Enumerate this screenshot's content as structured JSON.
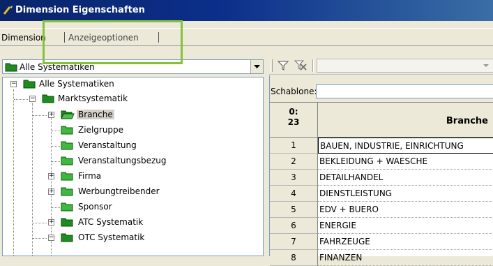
{
  "window": {
    "title": "Dimension Eigenschaften"
  },
  "tabs": [
    {
      "label": "Dimension"
    },
    {
      "label": "Anzeigeoptionen"
    }
  ],
  "systematik_select": {
    "value": "Alle Systematiken"
  },
  "tree": {
    "root": "Alle Systematiken",
    "markt": "Marktsystematik",
    "branche": "Branche",
    "zielgruppe": "Zielgruppe",
    "veranstaltung": "Veranstaltung",
    "veranstaltungsbezug": "Veranstaltungsbezug",
    "firma": "Firma",
    "werbungtreibender": "Werbungtreibender",
    "sponsor": "Sponsor",
    "atc": "ATC Systematik",
    "otc": "OTC Systematik"
  },
  "schablone": {
    "label": "Schablone:",
    "value": ""
  },
  "grid": {
    "num_header_line1": "0:",
    "num_header_line2": "23",
    "col_header": "Branche",
    "rows": [
      {
        "num": "1",
        "value": "BAUEN, INDUSTRIE, EINRICHTUNG"
      },
      {
        "num": "2",
        "value": "BEKLEIDUNG + WAESCHE"
      },
      {
        "num": "3",
        "value": "DETAILHANDEL"
      },
      {
        "num": "4",
        "value": "DIENSTLEISTUNG"
      },
      {
        "num": "5",
        "value": "EDV + BUERO"
      },
      {
        "num": "6",
        "value": "ENERGIE"
      },
      {
        "num": "7",
        "value": "FAHRZEUGE"
      },
      {
        "num": "8",
        "value": "FINANZEN"
      }
    ]
  },
  "colors": {
    "titlebar": "#0a246a",
    "highlight": "#86c13c",
    "folder_green": "#1e8c1e"
  }
}
